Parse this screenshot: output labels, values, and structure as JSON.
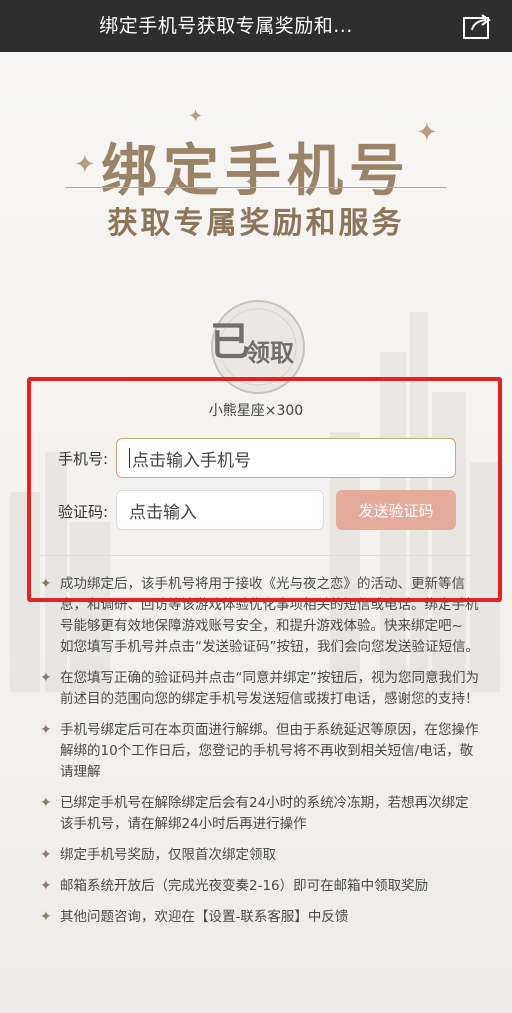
{
  "header": {
    "title": "绑定手机号获取专属奖励和...",
    "share_icon": "share-icon"
  },
  "banner": {
    "title": "绑定手机号",
    "subtitle": "获取专属奖励和服务"
  },
  "stamp": {
    "line1": "已",
    "line2": "领取"
  },
  "reward": {
    "text": "小熊星座×300"
  },
  "form": {
    "phone_label": "手机号:",
    "phone_placeholder": "点击输入手机号",
    "code_label": "验证码:",
    "code_placeholder": "点击输入",
    "send_button": "发送验证码"
  },
  "notes": [
    "成功绑定后，该手机号将用于接收《光与夜之恋》的活动、更新等信息，和调研、回访等该游戏体验优化事项相关的短信或电话。绑定手机号能够更有效地保障游戏账号安全，和提升游戏体验。快来绑定吧~\n如您填写手机号并点击“发送验证码”按钮，我们会向您发送验证短信。",
    "在您填写正确的验证码并点击“同意并绑定”按钮后，视为您同意我们为前述目的范围向您的绑定手机号发送短信或拨打电话，感谢您的支持！",
    "手机号绑定后可在本页面进行解绑。但由于系统延迟等原因，在您操作解绑的10个工作日后，您登记的手机号将不再收到相关短信/电话，敬请理解",
    "已绑定手机号在解除绑定后会有24小时的系统冷冻期，若想再次绑定该手机号，请在解绑24小时后再进行操作",
    "绑定手机号奖励，仅限首次绑定领取",
    "邮箱系统开放后（完成光夜变奏2-16）即可在邮箱中领取奖励",
    "其他问题咨询，欢迎在【设置-联系客服】中反馈"
  ],
  "colors": {
    "accent": "#9a8366",
    "button": "#e4aa9a",
    "highlight_frame": "#e52222"
  }
}
